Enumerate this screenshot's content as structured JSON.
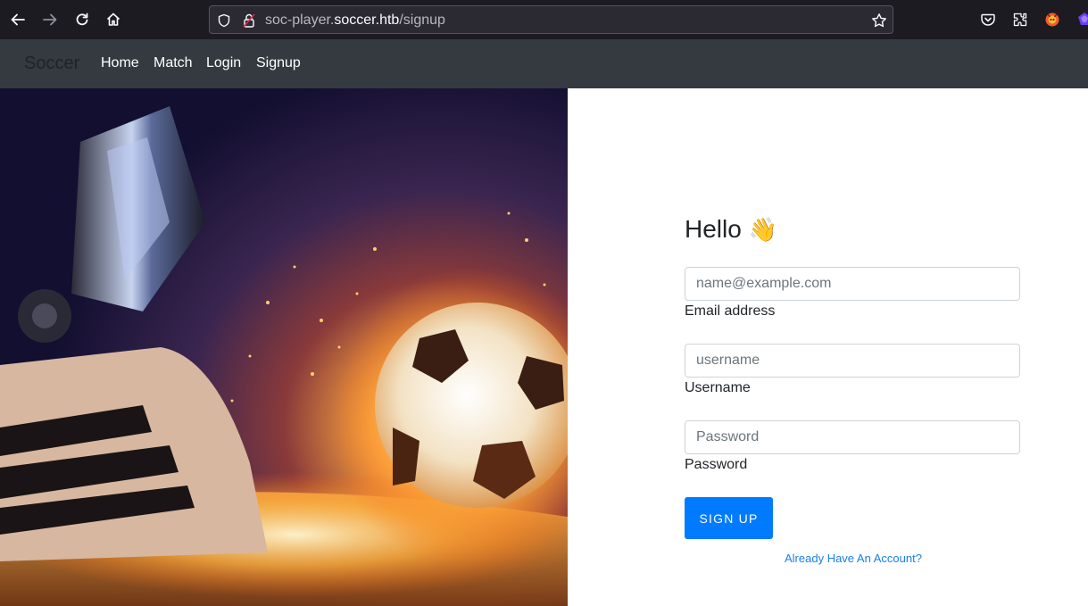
{
  "browser": {
    "url_prefix": "soc-player.",
    "url_host": "soccer.htb",
    "url_path": "/signup",
    "icons": [
      "back-icon",
      "forward-icon",
      "reload-icon",
      "home-icon",
      "shield-icon",
      "lock-icon",
      "star-icon",
      "pocket-icon",
      "extensions-icon",
      "firefox-extension-icon",
      "menu-icon"
    ]
  },
  "navbar": {
    "brand": "Soccer",
    "links": [
      "Home",
      "Match",
      "Login",
      "Signup"
    ]
  },
  "form": {
    "greeting": "Hello",
    "greeting_emoji": "👋",
    "email_placeholder": "name@example.com",
    "email_label": "Email address",
    "username_placeholder": "username",
    "username_label": "Username",
    "password_placeholder": "Password",
    "password_label": "Password",
    "submit_label": "SIGN UP",
    "account_link": "Already Have An Account?"
  },
  "colors": {
    "browser_bg": "#1c1b22",
    "navbar_bg": "#343a40",
    "primary": "#007bff",
    "link": "#1a7ee8"
  }
}
